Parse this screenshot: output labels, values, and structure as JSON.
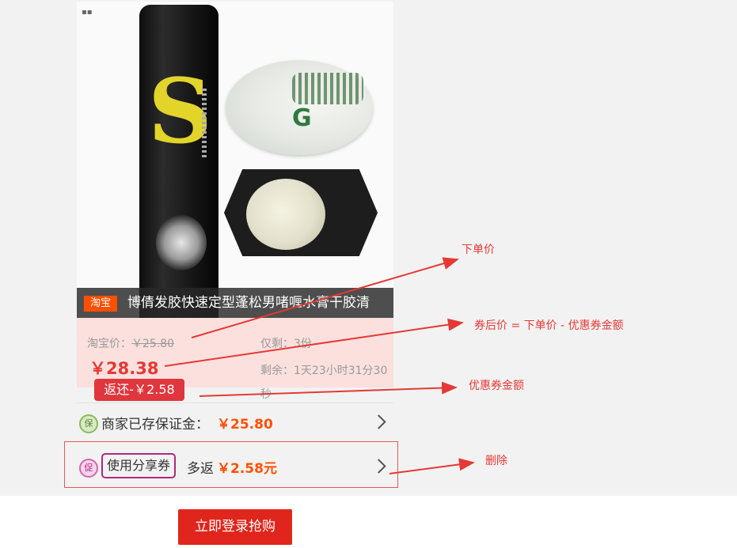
{
  "product": {
    "platform_tag": "淘宝",
    "title": "博倩发胶快速定型蓬松男啫喱水膏干胶清",
    "taobao_price_label": "淘宝价：",
    "taobao_price": "￥25.80",
    "final_price": "￥28.38",
    "stock_text": "仅剩：3份",
    "time_left_text": "剩余：1天23小时31分30秒",
    "rebate_badge": "返还-￥2.58"
  },
  "deposit": {
    "icon": "保",
    "label": "商家已存保证金：",
    "amount": "￥25.80"
  },
  "coupon": {
    "icon": "促",
    "button_label": "使用分享券",
    "extra_prefix": "多返",
    "extra_amount": "￥2.58元"
  },
  "buy_button": "立即登录抢购",
  "annotations": {
    "order_price": "下单价",
    "after_coupon_price": "券后价 = 下单价 - 优惠券金额",
    "coupon_amount": "优惠券金额",
    "delete": "删除"
  },
  "colors": {
    "accent_red": "#e53935",
    "taobao_orange": "#ff5000",
    "price_panel_bg": "#fbe0de",
    "promo_purple": "#b0287c"
  }
}
